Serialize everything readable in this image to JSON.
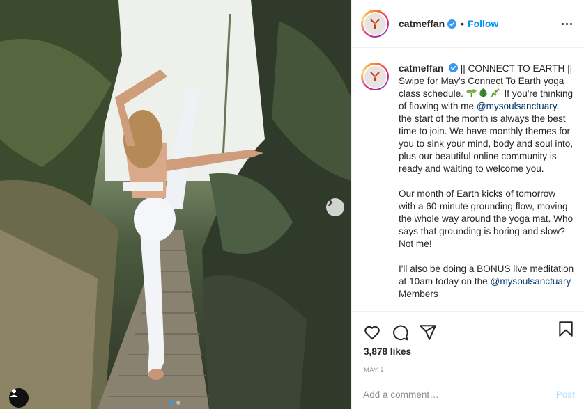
{
  "post": {
    "username": "catmeffan",
    "separator": "•",
    "follow_label": "Follow",
    "caption": {
      "username": "catmeffan",
      "line_intro": "|| CONNECT TO EARTH || Swipe for May's Connect To Earth yoga class schedule.",
      "line_after_emoji": "If you're thinking of flowing with me",
      "mention": "@mysoulsanctuary",
      "line_after_mention": ", the start of the month is always the best time to join. We have monthly themes for you to sink your mind, body and soul into, plus our beautiful online community is ready and waiting to welcome you.",
      "paragraph2": "Our month of Earth kicks of tomorrow with a 60-minute grounding flow, moving the whole way around the yoga mat. Who says that grounding is boring and slow? Not me!",
      "paragraph3_start": "I'll also be doing a BONUS live meditation at 10am today on the",
      "paragraph3_mention": "@mysoulsanctuary",
      "paragraph3_end": "Members"
    },
    "likes": "3,878 likes",
    "date": "MAY 2",
    "comment_placeholder": "Add a comment…",
    "post_label": "Post"
  },
  "carousel": {
    "count": 2,
    "active_index": 0
  },
  "colors": {
    "accent": "#0095f6",
    "mention": "#00376b",
    "muted": "#8e8e8e",
    "post_disabled": "#b3dbff",
    "carousel_active": "#3897f0"
  },
  "icons": [
    "verified-badge-icon",
    "more-options-icon",
    "heart-icon",
    "comment-icon",
    "share-icon",
    "bookmark-icon",
    "next-arrow-icon",
    "user-tag-icon",
    "seedling-emoji",
    "leaf-emoji",
    "herb-emoji"
  ]
}
